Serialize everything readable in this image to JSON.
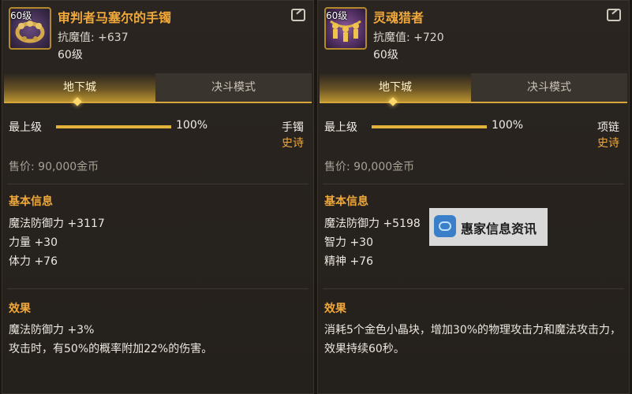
{
  "left": {
    "level_tag": "60级",
    "name": "审判者马塞尔的手镯",
    "resist": "抗魔值: +637",
    "level": "60级",
    "tabs": [
      "地下城",
      "决斗模式"
    ],
    "grade_label": "最上级",
    "grade_fill": 1.0,
    "grade_pct": "100%",
    "slot": "手镯",
    "rarity": "史诗",
    "price": "售价: 90,000金币",
    "basic_title": "基本信息",
    "stats": [
      "魔法防御力 +3117",
      "力量 +30",
      "体力 +76"
    ],
    "effect_title": "效果",
    "effects": [
      "魔法防御力 +3%",
      "攻击时，有50%的概率附加22%的伤害。"
    ]
  },
  "right": {
    "level_tag": "60级",
    "name": "灵魂猎者",
    "resist": "抗魔值: +720",
    "level": "60级",
    "tabs": [
      "地下城",
      "决斗模式"
    ],
    "grade_label": "最上级",
    "grade_fill": 1.0,
    "grade_pct": "100%",
    "slot": "项链",
    "rarity": "史诗",
    "price": "售价: 90,000金币",
    "basic_title": "基本信息",
    "stats": [
      "魔法防御力 +5198",
      "智力 +30",
      "精神 +76"
    ],
    "effect_title": "效果",
    "effects": [
      "消耗5个金色小晶块，增加30%的物理攻击力和魔法攻击力，效果持续60秒。"
    ]
  },
  "watermark": {
    "text": "惠家信息资讯"
  },
  "colors": {
    "item_name": "#f0a83a",
    "rarity": "#f0a83a",
    "bar_fill": "#e2b23a",
    "tab_underline": "#d6a63a",
    "background": "#24201c"
  },
  "icons": [
    "share-icon",
    "bracelet-item-icon",
    "necklace-item-icon",
    "watermark-logo-icon"
  ]
}
